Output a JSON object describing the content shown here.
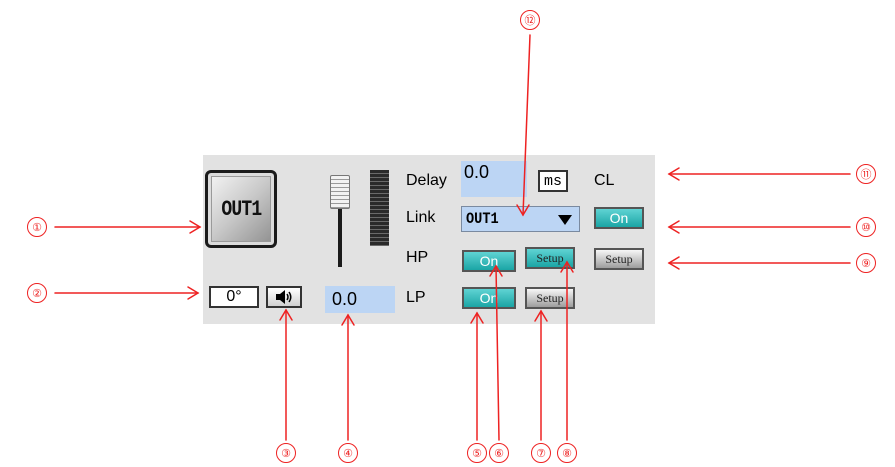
{
  "output_button": {
    "label": "OUT1"
  },
  "phase": {
    "value": "0°"
  },
  "mute": {
    "icon": "speaker-icon"
  },
  "gain": {
    "value": "0.0"
  },
  "delay": {
    "label": "Delay",
    "value": "0.0",
    "unit_button": "ms"
  },
  "link": {
    "label": "Link",
    "selected": "OUT1"
  },
  "hp": {
    "label": "HP",
    "on_label": "On",
    "setup_label": "Setup"
  },
  "lp": {
    "label": "LP",
    "on_label": "On",
    "setup_label": "Setup"
  },
  "cl": {
    "label": "CL",
    "on_label": "On",
    "setup_label": "Setup"
  },
  "callouts": [
    "①",
    "②",
    "③",
    "④",
    "⑤",
    "⑥",
    "⑦",
    "⑧",
    "⑨",
    "⑩",
    "⑪",
    "⑫"
  ],
  "colors": {
    "annotation": "#e22222",
    "accent_teal": "#1ba5a5",
    "field_blue": "#bcd5f4",
    "panel_bg": "#e2e2e2"
  }
}
